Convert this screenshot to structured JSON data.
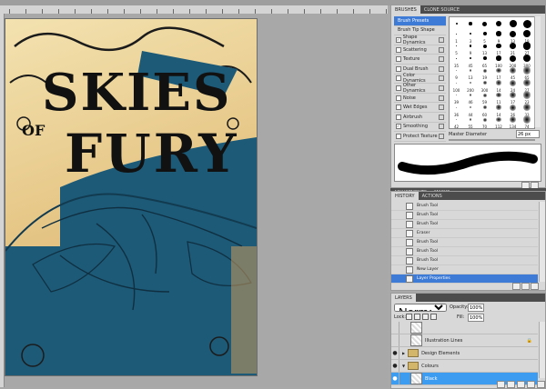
{
  "brushes_panel": {
    "tabs": [
      "BRUSHES",
      "CLONE SOURCE"
    ],
    "options": [
      {
        "label": "Brush Presets",
        "checked": null,
        "selected": true
      },
      {
        "label": "Brush Tip Shape",
        "checked": null,
        "selected": false
      },
      {
        "label": "Shape Dynamics",
        "checked": true,
        "selected": false
      },
      {
        "label": "Scattering",
        "checked": false,
        "selected": false
      },
      {
        "label": "Texture",
        "checked": false,
        "selected": false
      },
      {
        "label": "Dual Brush",
        "checked": false,
        "selected": false
      },
      {
        "label": "Color Dynamics",
        "checked": false,
        "selected": false
      },
      {
        "label": "Other Dynamics",
        "checked": false,
        "selected": false
      },
      {
        "label": "Noise",
        "checked": false,
        "selected": false
      },
      {
        "label": "Wet Edges",
        "checked": false,
        "selected": false
      },
      {
        "label": "Airbrush",
        "checked": false,
        "selected": false
      },
      {
        "label": "Smoothing",
        "checked": true,
        "selected": false
      },
      {
        "label": "Protect Texture",
        "checked": false,
        "selected": false
      }
    ],
    "brush_rows": [
      [
        "",
        "",
        "",
        "",
        "",
        ""
      ],
      [
        "1",
        "3",
        "5",
        "9",
        "13",
        "19"
      ],
      [
        "5",
        "9",
        "13",
        "17",
        "21",
        "27"
      ],
      [
        "35",
        "45",
        "65",
        "100",
        "200",
        "300"
      ],
      [
        "9",
        "13",
        "19",
        "17",
        "45",
        "65"
      ],
      [
        "100",
        "200",
        "300",
        "14",
        "24",
        "27"
      ],
      [
        "39",
        "46",
        "59",
        "11",
        "17",
        "23"
      ],
      [
        "36",
        "44",
        "60",
        "14",
        "26",
        "33"
      ],
      [
        "42",
        "55",
        "70",
        "112",
        "134",
        "74"
      ]
    ],
    "master_diameter_label": "Master Diameter",
    "master_diameter_value": "26 px"
  },
  "adjust_tabs": [
    "ADJUSTMENTS",
    "MASKS"
  ],
  "history_panel": {
    "tabs": [
      "HISTORY",
      "ACTIONS"
    ],
    "items": [
      "Brush Tool",
      "Brush Tool",
      "Brush Tool",
      "Eraser",
      "Brush Tool",
      "Brush Tool",
      "Brush Tool",
      "New Layer",
      "Layer Properties"
    ]
  },
  "layers_panel": {
    "tab": "LAYERS",
    "blend_mode": "Normal",
    "opacity_label": "Opacity:",
    "opacity_value": "100%",
    "lock_label": "Lock:",
    "fill_label": "Fill:",
    "fill_value": "100%",
    "layers": [
      {
        "name": "",
        "kind": "layer",
        "visible": false,
        "selected": false
      },
      {
        "name": "Illustration Lines",
        "kind": "layer",
        "visible": false,
        "selected": false
      },
      {
        "name": "Design Elements",
        "kind": "folder",
        "visible": true,
        "selected": false
      },
      {
        "name": "Colours",
        "kind": "folder",
        "visible": true,
        "selected": false
      },
      {
        "name": "Black",
        "kind": "layer",
        "visible": true,
        "selected": true
      }
    ]
  },
  "artwork": {
    "title_top": "SKIES",
    "title_of": "OF",
    "title_bottom": "FURY"
  },
  "colors": {
    "selection": "#3d7bd6",
    "layer_selection": "#3d9bf0",
    "poster_blue": "#1d5a78",
    "ink": "#111111"
  }
}
